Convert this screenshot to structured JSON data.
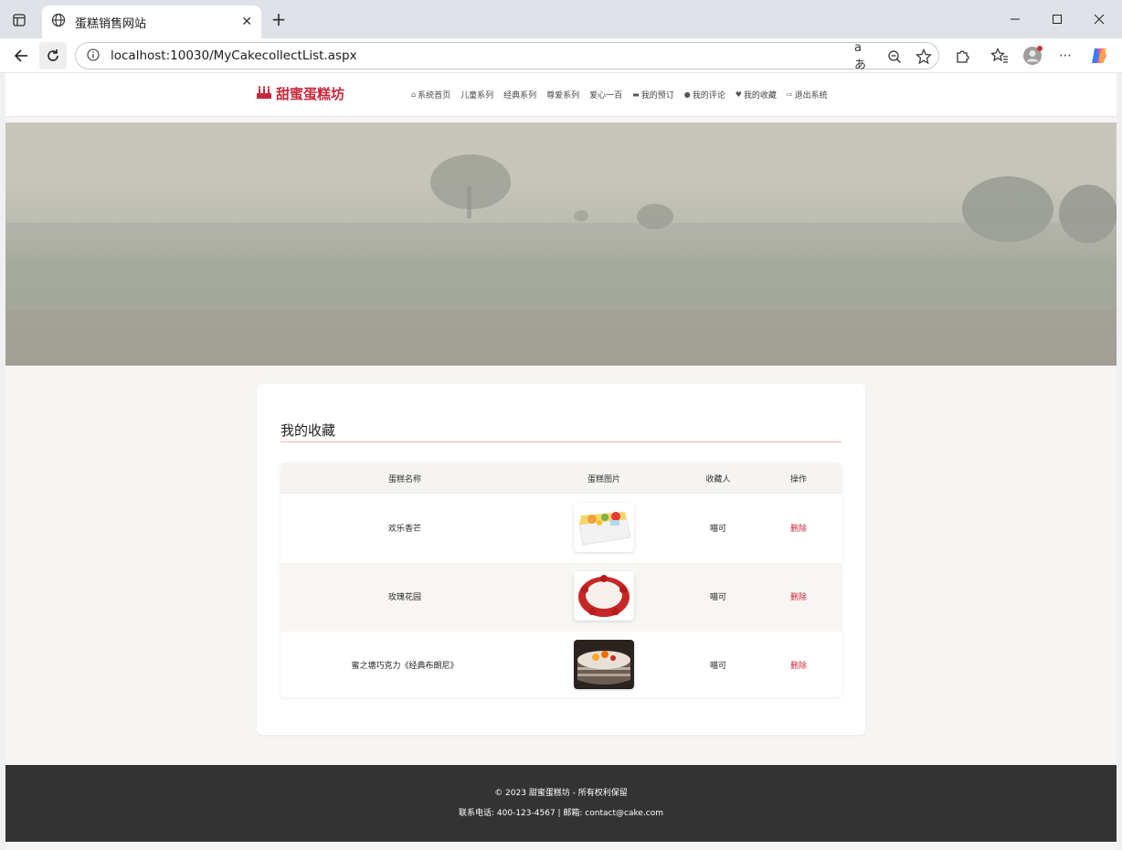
{
  "browser": {
    "tab_title": "蛋糕销售网站",
    "url": "localhost:10030/MyCakecollectList.aspx"
  },
  "site": {
    "logo_text": "甜蜜蛋糕坊",
    "brand_color": "#c8283a",
    "menu": [
      {
        "label": "系统首页",
        "icon": "home-icon"
      },
      {
        "label": "儿童系列",
        "icon": ""
      },
      {
        "label": "经典系列",
        "icon": ""
      },
      {
        "label": "尊爱系列",
        "icon": ""
      },
      {
        "label": "爱心一百",
        "icon": ""
      },
      {
        "label": "我的预订",
        "icon": "card-icon"
      },
      {
        "label": "我的评论",
        "icon": "comments-icon"
      },
      {
        "label": "我的收藏",
        "icon": "heart-icon"
      },
      {
        "label": "退出系统",
        "icon": "logout-icon"
      }
    ]
  },
  "collection": {
    "title": "我的收藏",
    "columns": [
      "蛋糕名称",
      "蛋糕图片",
      "收藏人",
      "操作"
    ],
    "rows": [
      {
        "name": "欢乐香芒",
        "collector": "喵可",
        "action": "删除",
        "image": "fruit-cake"
      },
      {
        "name": "玫瑰花园",
        "collector": "喵可",
        "action": "删除",
        "image": "rose-cake"
      },
      {
        "name": "蜜之塘巧克力《经典布朗尼》",
        "collector": "喵可",
        "action": "删除",
        "image": "chocolate-cake"
      }
    ]
  },
  "footer": {
    "copyright": "© 2023 甜蜜蛋糕坊 - 所有权利保留",
    "contact": "联系电话: 400-123-4567 | 邮箱: contact@cake.com"
  }
}
